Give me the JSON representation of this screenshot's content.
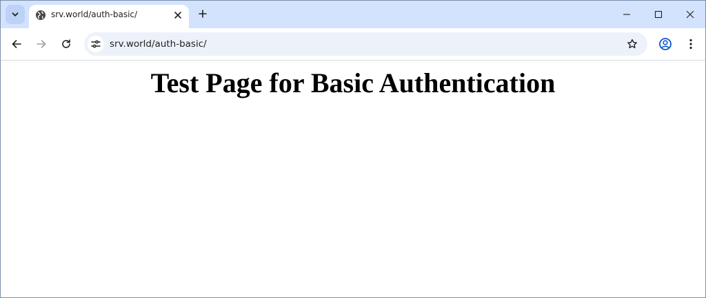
{
  "browser": {
    "tab": {
      "title": "srv.world/auth-basic/",
      "favicon": "globe-icon"
    },
    "address_bar": {
      "url": "srv.world/auth-basic/"
    },
    "icons": {
      "tab_search": "chevron-down-icon",
      "tab_close": "close-icon",
      "new_tab": "plus-icon",
      "minimize": "minimize-icon",
      "maximize": "maximize-icon",
      "close_window": "close-icon",
      "back": "arrow-left-icon",
      "forward": "arrow-right-icon",
      "reload": "reload-icon",
      "site_info": "tune-icon",
      "bookmark": "star-icon",
      "profile": "account-icon",
      "menu": "more-vertical-icon"
    },
    "colors": {
      "tabstrip": "#d3e3fd",
      "omnibox": "#edf2fa",
      "profile_accent": "#0b57d0"
    }
  },
  "page": {
    "heading": "Test Page for Basic Authentication"
  }
}
